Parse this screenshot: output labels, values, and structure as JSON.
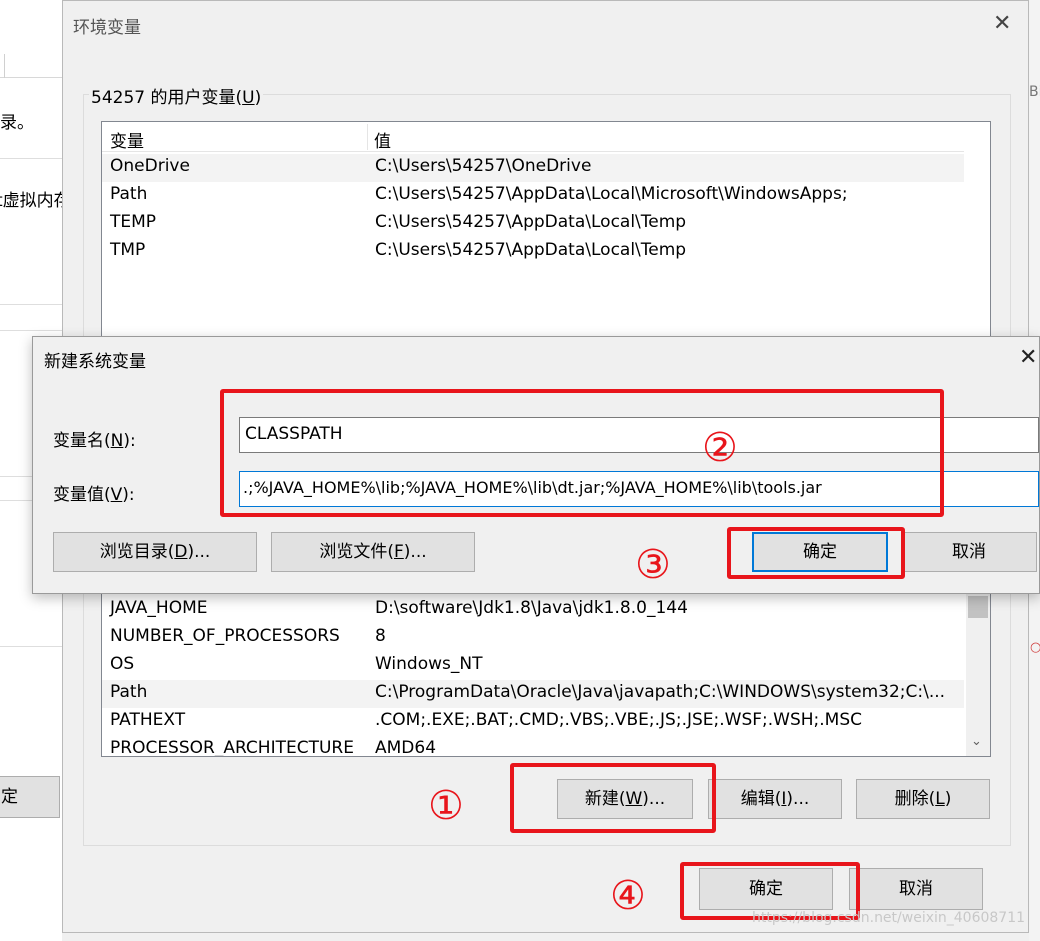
{
  "background_window": {
    "fragments": [
      "录。",
      "t虚拟内存",
      "定"
    ]
  },
  "background_right": {
    "fragment": "Bi"
  },
  "env_window": {
    "title": "环境变量",
    "user_group_label_prefix": "54257 的用户变量(",
    "user_group_label_key": "U",
    "user_group_label_suffix": ")",
    "columns": {
      "name": "变量",
      "value": "值"
    },
    "user_variables": [
      {
        "name": "OneDrive",
        "value": "C:\\Users\\54257\\OneDrive"
      },
      {
        "name": "Path",
        "value": "C:\\Users\\54257\\AppData\\Local\\Microsoft\\WindowsApps;"
      },
      {
        "name": "TEMP",
        "value": "C:\\Users\\54257\\AppData\\Local\\Temp"
      },
      {
        "name": "TMP",
        "value": "C:\\Users\\54257\\AppData\\Local\\Temp"
      }
    ],
    "system_variables": [
      {
        "name": "JAVA_HOME",
        "value": "D:\\software\\Jdk1.8\\Java\\jdk1.8.0_144"
      },
      {
        "name": "NUMBER_OF_PROCESSORS",
        "value": "8"
      },
      {
        "name": "OS",
        "value": "Windows_NT"
      },
      {
        "name": "Path",
        "value": "C:\\ProgramData\\Oracle\\Java\\javapath;C:\\WINDOWS\\system32;C:\\..."
      },
      {
        "name": "PATHEXT",
        "value": ".COM;.EXE;.BAT;.CMD;.VBS;.VBE;.JS;.JSE;.WSF;.WSH;.MSC"
      },
      {
        "name": "PROCESSOR_ARCHITECTURE",
        "value": "AMD64"
      }
    ],
    "buttons": {
      "new_prefix": "新建(",
      "new_key": "W",
      "new_suffix": ")...",
      "edit_prefix": "编辑(",
      "edit_key": "I",
      "edit_suffix": ")...",
      "delete_prefix": "删除(",
      "delete_key": "L",
      "delete_suffix": ")",
      "ok": "确定",
      "cancel": "取消"
    }
  },
  "new_var_dialog": {
    "title": "新建系统变量",
    "name_label_prefix": "变量名(",
    "name_label_key": "N",
    "name_label_suffix": "):",
    "value_label_prefix": "变量值(",
    "value_label_key": "V",
    "value_label_suffix": "):",
    "name_value": "CLASSPATH",
    "value_value": ".;%JAVA_HOME%\\lib;%JAVA_HOME%\\lib\\dt.jar;%JAVA_HOME%\\lib\\tools.jar",
    "buttons": {
      "browse_dir_prefix": "浏览目录(",
      "browse_dir_key": "D",
      "browse_dir_suffix": ")...",
      "browse_file_prefix": "浏览文件(",
      "browse_file_key": "F",
      "browse_file_suffix": ")...",
      "ok": "确定",
      "cancel": "取消"
    }
  },
  "annotations": {
    "step1": "①",
    "step2": "②",
    "step3": "③",
    "step4": "④",
    "color": "#e8151b"
  },
  "watermark": "https://blog.csdn.net/weixin_40608711"
}
